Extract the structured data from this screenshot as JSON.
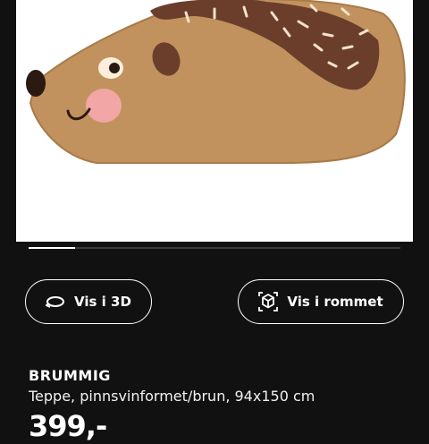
{
  "product_image": {
    "alt": "BRUMMIG hedgehog rug"
  },
  "buttons": {
    "view_3d": {
      "label": "Vis i 3D",
      "icon": "rotate-3d-icon"
    },
    "view_room": {
      "label": "Vis i rommet",
      "icon": "ar-cube-icon"
    }
  },
  "product": {
    "name": "BRUMMIG",
    "description": "Teppe, pinnsvinformet/brun, 94x150 cm",
    "price": "399,-"
  },
  "colors": {
    "background": "#111111",
    "rug_body": "#c1925d",
    "rug_spines": "#6b3e2c",
    "cheek": "#f2a6a6"
  }
}
